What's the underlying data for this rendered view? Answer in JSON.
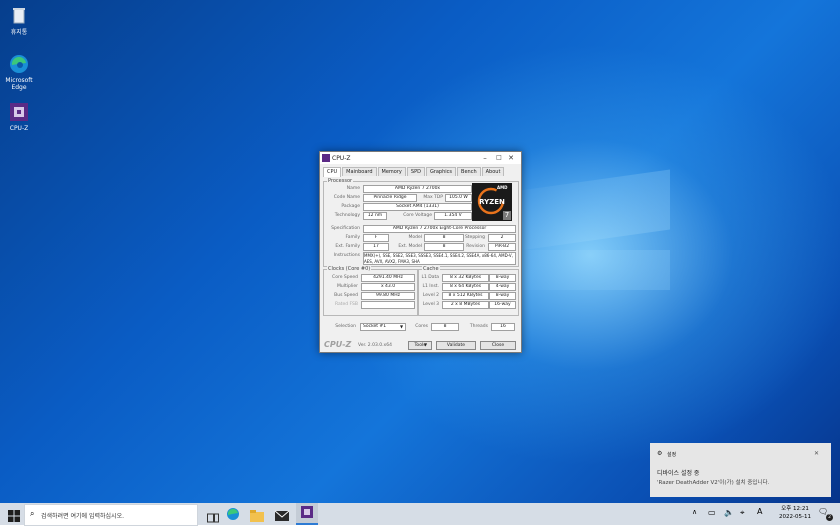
{
  "desktop": {
    "icons": [
      {
        "label": "휴지통",
        "icon": "recycle-bin-icon"
      },
      {
        "label": "Microsoft Edge",
        "icon": "edge-icon"
      },
      {
        "label": "CPU-Z",
        "icon": "cpuz-icon"
      }
    ]
  },
  "window": {
    "title": "CPU-Z",
    "tabs": [
      "CPU",
      "Mainboard",
      "Memory",
      "SPD",
      "Graphics",
      "Bench",
      "About"
    ],
    "processor": {
      "section": "Processor",
      "name_label": "Name",
      "name": "AMD Ryzen 7 2700x",
      "codename_label": "Code Name",
      "codename": "Pinnacle Ridge",
      "maxtdp_label": "Max TDP",
      "maxtdp": "105.0 W",
      "package_label": "Package",
      "package": "Socket AM4 (1331)",
      "technology_label": "Technology",
      "technology": "12 nm",
      "corevoltage_label": "Core Voltage",
      "corevoltage": "1.354 V",
      "spec_label": "Specification",
      "spec": "AMD Ryzen 7 2700x Eight-Core Processor",
      "family_label": "Family",
      "family": "F",
      "model_label": "Model",
      "model": "8",
      "stepping_label": "Stepping",
      "stepping": "2",
      "extfamily_label": "Ext. Family",
      "extfamily": "17",
      "extmodel_label": "Ext. Model",
      "extmodel": "8",
      "revision_label": "Revision",
      "revision": "PiR-B2",
      "instructions_label": "Instructions",
      "instructions": "MMX(+), SSE, SSE2, SSE3, SSSE3, SSE4.1, SSE4.2, SSE4A, x86-64, AMD-V, AES, AVX, AVX2, FMA3, SHA"
    },
    "clocks": {
      "section": "Clocks (Core #0)",
      "corespeed_label": "Core Speed",
      "corespeed": "4291.40 MHz",
      "multiplier_label": "Multiplier",
      "multiplier": "x 43.0",
      "busspeed_label": "Bus Speed",
      "busspeed": "99.80 MHz",
      "ratedfsb_label": "Rated FSB",
      "ratedfsb": ""
    },
    "cache": {
      "section": "Cache",
      "rows": [
        {
          "label": "L1 Data",
          "size": "8 x 32 KBytes",
          "way": "8-way"
        },
        {
          "label": "L1 Inst.",
          "size": "8 x 64 KBytes",
          "way": "4-way"
        },
        {
          "label": "Level 2",
          "size": "8 x 512 KBytes",
          "way": "8-way"
        },
        {
          "label": "Level 3",
          "size": "2 x 8 MBytes",
          "way": "16-way"
        }
      ]
    },
    "selection_label": "Selection",
    "selection": "Socket #1",
    "cores_label": "Cores",
    "cores": "8",
    "threads_label": "Threads",
    "threads": "16",
    "brand": "CPU-Z",
    "version": "Ver. 2.03.0.x64",
    "tools_label": "Tools",
    "validate_label": "Validate",
    "close_label": "Close",
    "logo_text": "RYZEN",
    "logo_digit": "7",
    "logo_brand": "AMD"
  },
  "notification": {
    "app": "설정",
    "title": "디바이스 설정 중",
    "body": "'Razer DeathAdder V2'이(가) 설치 중입니다."
  },
  "taskbar": {
    "search_placeholder": "검색하려면 여기에 입력하십시오.",
    "language": "A",
    "time": "오후 12:21",
    "date": "2022-05-11",
    "notif_count": "2"
  }
}
